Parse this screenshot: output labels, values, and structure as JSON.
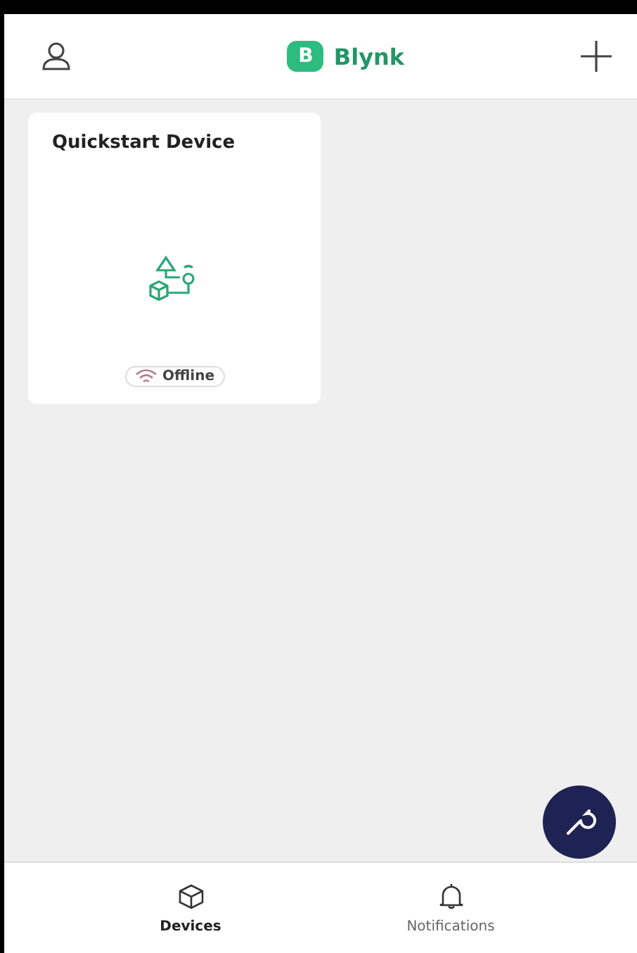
{
  "header": {
    "logo_letter": "B",
    "title": "Blynk"
  },
  "devices": [
    {
      "name": "Quickstart Device",
      "status": "Offline",
      "online": false
    }
  ],
  "tabs": [
    {
      "label": "Devices",
      "selected": true,
      "kind": "devices"
    },
    {
      "label": "Notifications",
      "selected": false,
      "kind": "notifications"
    }
  ]
}
